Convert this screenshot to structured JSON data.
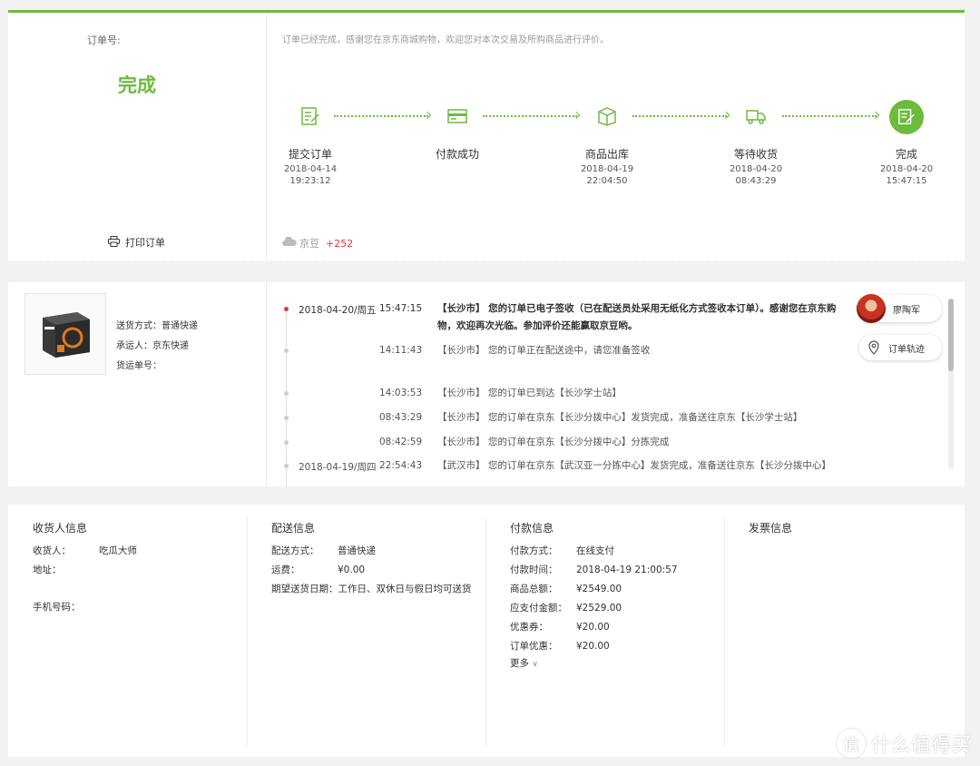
{
  "order": {
    "number_label": "订单号:",
    "status": "完成",
    "print_label": "打印订单",
    "thanks": "订单已经完成，感谢您在京东商城购物，欢迎您对本次交易及所购商品进行评价。",
    "beans_label": "京豆",
    "beans_value": "+252",
    "accent_color": "#6dbb3c"
  },
  "steps": [
    {
      "label": "提交订单",
      "date": "2018-04-14",
      "time": "19:23:12",
      "icon": "submit-order-icon"
    },
    {
      "label": "付款成功",
      "date": "",
      "time": "",
      "icon": "payment-icon"
    },
    {
      "label": "商品出库",
      "date": "2018-04-19",
      "time": "22:04:50",
      "icon": "package-icon"
    },
    {
      "label": "等待收货",
      "date": "2018-04-20",
      "time": "08:43:29",
      "icon": "truck-icon"
    },
    {
      "label": "完成",
      "date": "2018-04-20",
      "time": "15:47:15",
      "icon": "complete-icon"
    }
  ],
  "shipping": {
    "method": "送货方式：普通快递",
    "carrier": "承运人：京东快递",
    "tracking": "货运单号：",
    "product_brand": "RYZEN"
  },
  "tracking_log": [
    {
      "date": "2018-04-20/周五",
      "time": "15:47:15",
      "text": "【长沙市】 您的订单已电子签收（已在配送员处采用无纸化方式签收本订单）。感谢您在京东购物，欢迎再次光临。参加评价还能赢取京豆哟。"
    },
    {
      "date": "",
      "time": "14:11:43",
      "text": "【长沙市】 您的订单正在配送途中，请您准备签收"
    },
    {
      "date": "",
      "time": "14:03:53",
      "text": "【长沙市】 您的订单已到达【长沙学士站】"
    },
    {
      "date": "",
      "time": "08:43:29",
      "text": "【长沙市】 您的订单在京东【长沙分拨中心】发货完成，准备送往京东【长沙学士站】"
    },
    {
      "date": "",
      "time": "08:42:59",
      "text": "【长沙市】 您的订单在京东【长沙分拨中心】分拣完成"
    },
    {
      "date": "2018-04-19/周四",
      "time": "22:54:43",
      "text": "【武汉市】 您的订单在京东【武汉亚一分拣中心】发货完成，准备送往京东【长沙分拨中心】"
    }
  ],
  "courier": {
    "name": "廖陶军",
    "track_label": "订单轨迹"
  },
  "receiver": {
    "title": "收货人信息",
    "name_k": "收货人：",
    "name_v": "吃瓜大师",
    "addr_k": "地址：",
    "addr_v": "",
    "phone_k": "手机号码：",
    "phone_v": ""
  },
  "delivery": {
    "title": "配送信息",
    "method_k": "配送方式：",
    "method_v": "普通快递",
    "fee_k": "运费：",
    "fee_v": "¥0.00",
    "date_k": "期望送货日期：",
    "date_v": "工作日、双休日与假日均可送货"
  },
  "payment": {
    "title": "付款信息",
    "rows": [
      {
        "k": "付款方式：",
        "v": "在线支付"
      },
      {
        "k": "付款时间：",
        "v": "2018-04-19 21:00:57"
      },
      {
        "k": "商品总额：",
        "v": "¥2549.00"
      },
      {
        "k": "应支付金额：",
        "v": "¥2529.00"
      },
      {
        "k": "优惠券：",
        "v": "¥20.00"
      },
      {
        "k": "订单优惠：",
        "v": "¥20.00"
      }
    ],
    "more": "更多"
  },
  "invoice": {
    "title": "发票信息"
  },
  "watermark": {
    "logo": "值",
    "text": "什么值得买"
  }
}
